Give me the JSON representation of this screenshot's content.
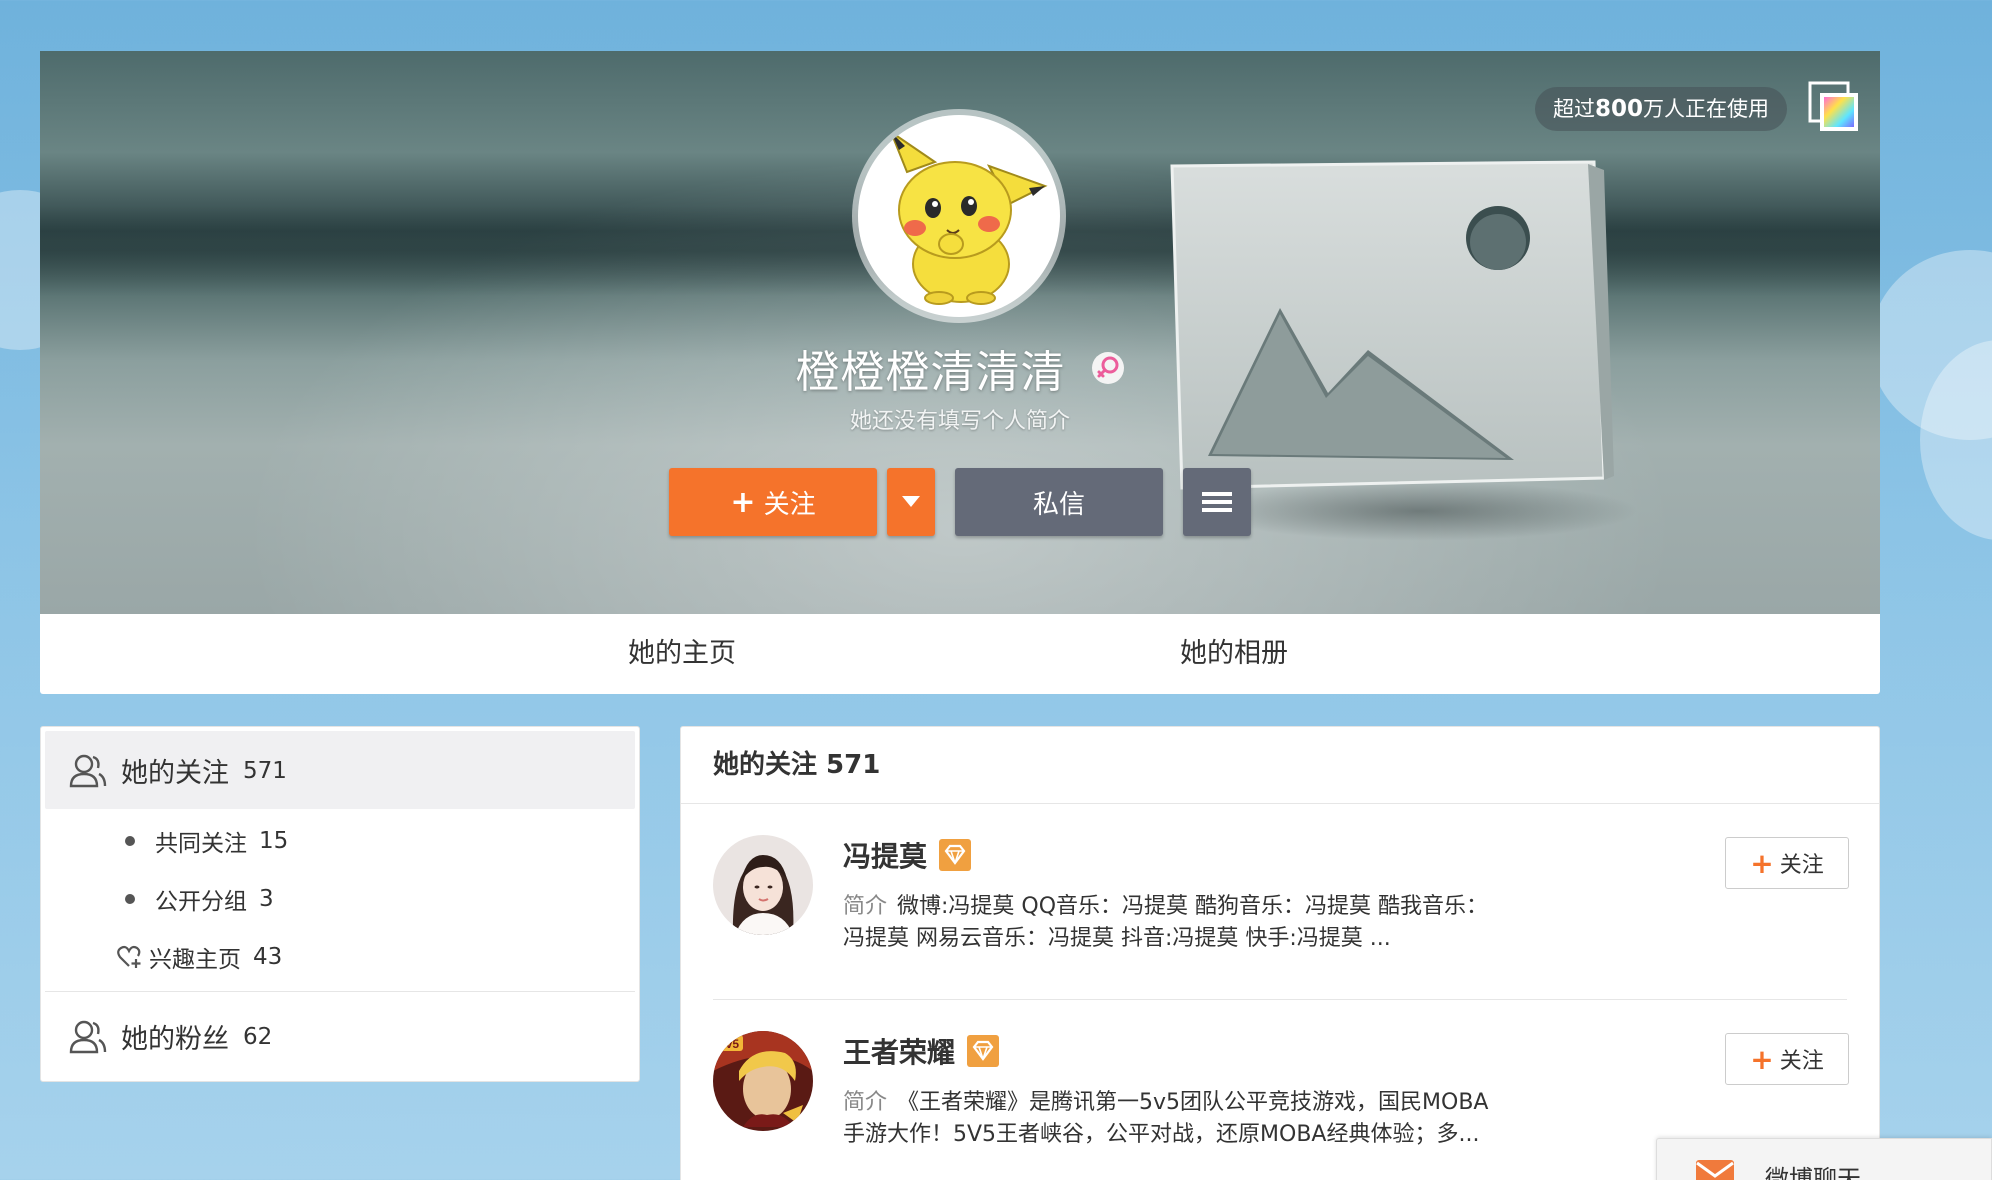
{
  "header": {
    "users_prefix": "超过",
    "users_count": "800",
    "users_suffix": "万人正在使用"
  },
  "profile": {
    "name": "橙橙橙清清清",
    "bio": "她还没有填写个人简介",
    "follow_label": "关注",
    "message_label": "私信"
  },
  "tabs": {
    "home": "她的主页",
    "album": "她的相册"
  },
  "sidebar": {
    "following_label": "她的关注",
    "following_count": "571",
    "sub_items": [
      {
        "label": "共同关注",
        "count": "15",
        "icon": "dot"
      },
      {
        "label": "公开分组",
        "count": "3",
        "icon": "dot"
      },
      {
        "label": "兴趣主页",
        "count": "43",
        "icon": "heart-plus-icon"
      }
    ],
    "fans_label": "她的粉丝",
    "fans_count": "62"
  },
  "main": {
    "title": "她的关注 571",
    "bio_label": "简介",
    "follow_label": "关注",
    "users": [
      {
        "name": "冯提莫",
        "bio_line1": "微博:冯提莫 QQ音乐：冯提莫 酷狗音乐：冯提莫 酷我音乐：",
        "bio_line2": "冯提莫 网易云音乐：冯提莫 抖音:冯提莫 快手:冯提莫 ..."
      },
      {
        "name": "王者荣耀",
        "bio_line1": "《王者荣耀》是腾讯第一5v5团队公平竞技游戏，国民MOBA",
        "bio_line2": "手游大作！5V5王者峡谷，公平对战，还原MOBA经典体验；多..."
      }
    ]
  },
  "chat": {
    "label": "微博聊天"
  },
  "colors": {
    "accent_orange": "#f5732b",
    "button_gray": "#646a78",
    "verified_badge": "#f0a040"
  }
}
